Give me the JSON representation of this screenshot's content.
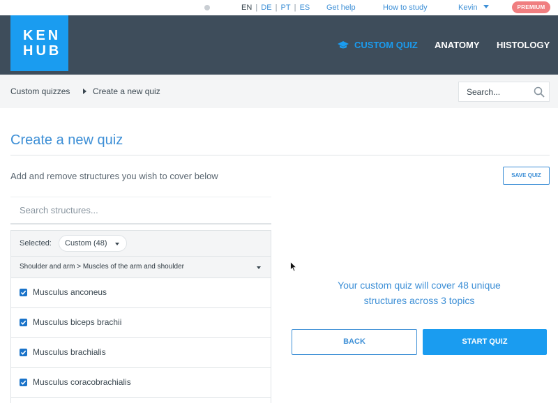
{
  "topbar": {
    "languages": [
      {
        "code": "EN",
        "active": true
      },
      {
        "code": "DE",
        "active": false
      },
      {
        "code": "PT",
        "active": false
      },
      {
        "code": "ES",
        "active": false
      }
    ],
    "get_help": "Get help",
    "how_to_study": "How to study",
    "user_name": "Kevin",
    "premium_label": "PREMIUM"
  },
  "header": {
    "logo_line1": "KEN",
    "logo_line2": "HUB",
    "nav": {
      "custom_quiz": "CUSTOM QUIZ",
      "anatomy": "ANATOMY",
      "histology": "HISTOLOGY"
    }
  },
  "breadcrumb": {
    "items": [
      "Custom quizzes",
      "Create a new quiz"
    ]
  },
  "search": {
    "placeholder": "Search..."
  },
  "main": {
    "title": "Create a new quiz",
    "subtitle": "Add and remove structures you wish to cover below",
    "save_label": "SAVE QUIZ",
    "structure_search_placeholder": "Search structures...",
    "selected_label": "Selected:",
    "selected_value": "Custom (48)",
    "topic_path": "Shoulder and arm > Muscles of the arm and shoulder",
    "structures": [
      {
        "name": "Musculus anconeus",
        "checked": true
      },
      {
        "name": "Musculus biceps brachii",
        "checked": true
      },
      {
        "name": "Musculus brachialis",
        "checked": true
      },
      {
        "name": "Musculus coracobrachialis",
        "checked": true
      }
    ],
    "cover_line1": "Your custom quiz will cover 48 unique",
    "cover_line2": "structures across 3 topics",
    "back_label": "BACK",
    "start_label": "START QUIZ"
  },
  "colors": {
    "brand_blue": "#1a9cf0",
    "header_bg": "#3e4d5b",
    "premium_pink": "#f07e80",
    "link_blue": "#3d8fd6"
  }
}
